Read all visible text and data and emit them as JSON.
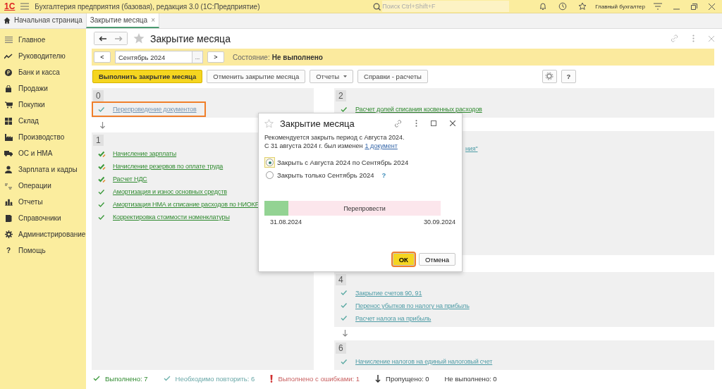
{
  "app": {
    "logo": "1С",
    "title": "Бухгалтерия предприятия (базовая), редакция 3.0  (1С:Предприятие)",
    "search_placeholder": "Поиск Ctrl+Shift+F",
    "user": "Главный бухгалтер"
  },
  "tabs": [
    {
      "label": "Начальная страница",
      "kind": "home",
      "selected": false
    },
    {
      "label": "Закрытие месяца",
      "kind": "doc",
      "selected": true,
      "close": "×"
    }
  ],
  "sidebar": [
    {
      "label": "Главное",
      "kind": "menu"
    },
    {
      "label": "Руководителю",
      "kind": "trend"
    },
    {
      "label": "Банк и касса",
      "kind": "coin"
    },
    {
      "label": "Продажи",
      "kind": "bag"
    },
    {
      "label": "Покупки",
      "kind": "cart"
    },
    {
      "label": "Склад",
      "kind": "grid"
    },
    {
      "label": "Производство",
      "kind": "factory"
    },
    {
      "label": "ОС и НМА",
      "kind": "truck"
    },
    {
      "label": "Зарплата и кадры",
      "kind": "person"
    },
    {
      "label": "Операции",
      "kind": "ledger"
    },
    {
      "label": "Отчеты",
      "kind": "bars"
    },
    {
      "label": "Справочники",
      "kind": "book"
    },
    {
      "label": "Администрирование",
      "kind": "gear"
    },
    {
      "label": "Помощь",
      "kind": "help",
      "icon_text": "?"
    }
  ],
  "form": {
    "title": "Закрытие месяца",
    "prev": "<",
    "period": "Сентябрь 2024",
    "choose": "...",
    "next": ">",
    "state_label": "Состояние:",
    "state_value": "Не выполнено",
    "buttons": [
      {
        "label": "Выполнить закрытие месяца",
        "kind": "primary"
      },
      {
        "label": "Отменить закрытие месяца",
        "kind": "normal"
      },
      {
        "label": "Отчеты",
        "kind": "dropdown"
      },
      {
        "label": "Справки - расчеты",
        "kind": "normal"
      }
    ],
    "help": "?"
  },
  "columns": [
    [
      {
        "number": "0",
        "arrow_before": false,
        "items": [
          {
            "label": "Перепроведение документов",
            "kind": "repeat",
            "highlighted": true
          }
        ]
      },
      {
        "number": "1",
        "arrow_before": true,
        "items": [
          {
            "label": "Начисление зарплаты",
            "kind": "changed",
            "highlighted": false
          },
          {
            "label": "Начисление резервов по оплате труда",
            "kind": "changed",
            "highlighted": false
          },
          {
            "label": "Расчет НДС",
            "kind": "changed",
            "highlighted": false
          },
          {
            "label": "Амортизация и износ основных средств",
            "kind": "done",
            "highlighted": false
          },
          {
            "label": "Амортизация НМА и списание расходов по НИОКР",
            "kind": "done",
            "highlighted": false
          },
          {
            "label": "Корректировка стоимости номенклатуры",
            "kind": "done",
            "highlighted": false
          }
        ]
      }
    ],
    [
      {
        "number": "2",
        "arrow_before": false,
        "items": [
          {
            "label": "Расчет долей списания косвенных расходов",
            "kind": "done",
            "highlighted": false
          }
        ]
      },
      {
        "arrow_before": false,
        "items": [
          {
            "label": "ния\"",
            "kind": "repeat",
            "highlighted": false
          }
        ]
      },
      {
        "number": "4",
        "arrow_before": false,
        "items": [
          {
            "label": "Закрытие счетов 90, 91",
            "kind": "repeat",
            "highlighted": false
          },
          {
            "label": "Перенос убытков по налогу на прибыль",
            "kind": "repeat",
            "highlighted": false
          },
          {
            "label": "Расчет налога на прибыль",
            "kind": "repeat",
            "highlighted": false
          }
        ]
      },
      {
        "number": "6",
        "arrow_before": true,
        "items": [
          {
            "label": "Начисление налогов на единый налоговый счет",
            "kind": "repeat",
            "highlighted": false
          }
        ]
      }
    ]
  ],
  "status_bar": [
    {
      "kind": "done",
      "label": "Выполнено: 7"
    },
    {
      "kind": "repeat",
      "label": "Необходимо повторить: 6"
    },
    {
      "kind": "error",
      "label": "Выполнено с ошибками: 1"
    },
    {
      "kind": "skipped",
      "label": "Пропущено: 0"
    },
    {
      "kind": "not_done",
      "label": "Не выполнено: 0"
    }
  ],
  "dialog": {
    "title": "Закрытие месяца",
    "line1": "Рекомендуется закрыть период с Августа 2024.",
    "line2": "С 31 августа 2024 г. был изменен",
    "link": "1 документ",
    "options": [
      {
        "label": "Закрыть с Августа 2024 по Сентябрь 2024",
        "selected": true
      },
      {
        "label": "Закрыть только Сентябрь 2024",
        "selected": false,
        "help": "?"
      }
    ],
    "timeline": [
      {
        "kind": "ok"
      },
      {
        "kind": "repost",
        "label": "Перепровести"
      }
    ],
    "date_start": "31.08.2024",
    "date_end": "30.09.2024",
    "buttons": [
      {
        "label": "ОК",
        "kind": "primary",
        "highlighted": true
      },
      {
        "label": "Отмена",
        "kind": "normal",
        "highlighted": false
      }
    ]
  }
}
